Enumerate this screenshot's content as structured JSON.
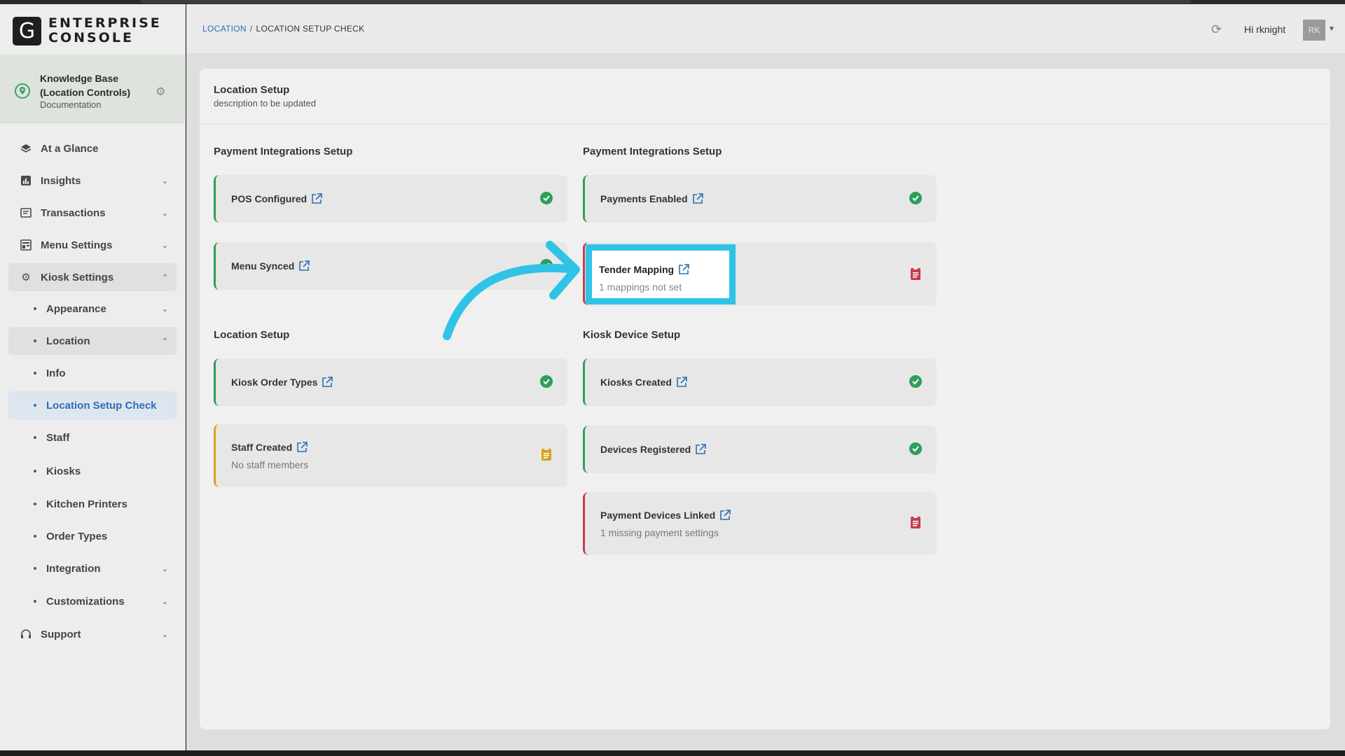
{
  "app": {
    "logo_letter": "G",
    "logo_line1": "ENTERPRISE",
    "logo_line2": "CONSOLE"
  },
  "org": {
    "name": "Knowledge Base (Location Controls)",
    "subtitle": "Documentation"
  },
  "sidebar": {
    "items": [
      {
        "label": "At a Glance",
        "icon": "layers-icon"
      },
      {
        "label": "Insights",
        "icon": "chart-icon"
      },
      {
        "label": "Transactions",
        "icon": "receipt-icon"
      },
      {
        "label": "Menu Settings",
        "icon": "menu-icon"
      },
      {
        "label": "Kiosk Settings",
        "icon": "gear-icon"
      },
      {
        "label": "Appearance"
      },
      {
        "label": "Location"
      },
      {
        "label": "Info"
      },
      {
        "label": "Location Setup Check"
      },
      {
        "label": "Staff"
      },
      {
        "label": "Kiosks"
      },
      {
        "label": "Kitchen Printers"
      },
      {
        "label": "Order Types"
      },
      {
        "label": "Integration"
      },
      {
        "label": "Customizations"
      },
      {
        "label": "Support",
        "icon": "headset-icon"
      }
    ]
  },
  "header": {
    "breadcrumb_link": "LOCATION",
    "breadcrumb_sep": "/",
    "breadcrumb_current": "LOCATION SETUP CHECK",
    "greeting": "Hi rknight",
    "avatar_initials": "RK"
  },
  "panel": {
    "title": "Location Setup",
    "description": "description to be updated"
  },
  "sections": {
    "left_payment_title": "Payment Integrations Setup",
    "right_payment_title": "Payment Integrations Setup",
    "location_title": "Location Setup",
    "kiosk_device_title": "Kiosk Device Setup"
  },
  "cards": {
    "pos_configured": {
      "title": "POS Configured",
      "status": "ok"
    },
    "menu_synced": {
      "title": "Menu Synced",
      "status": "ok"
    },
    "payments_enabled": {
      "title": "Payments Enabled",
      "status": "ok"
    },
    "tender_mapping": {
      "title": "Tender Mapping",
      "subtitle": "1 mappings not set",
      "status": "error"
    },
    "kiosk_order_types": {
      "title": "Kiosk Order Types",
      "status": "ok"
    },
    "staff_created": {
      "title": "Staff Created",
      "subtitle": "No staff members",
      "status": "warning"
    },
    "kiosks_created": {
      "title": "Kiosks Created",
      "status": "ok"
    },
    "devices_registered": {
      "title": "Devices Registered",
      "status": "ok"
    },
    "payment_devices_linked": {
      "title": "Payment Devices Linked",
      "subtitle": "1 missing payment settings",
      "status": "error"
    }
  },
  "colors": {
    "accent": "#2d6fb5",
    "ok": "#2e9e5b",
    "warning": "#d9a21b",
    "error": "#c93a4e",
    "highlight": "#2fc3e6"
  }
}
